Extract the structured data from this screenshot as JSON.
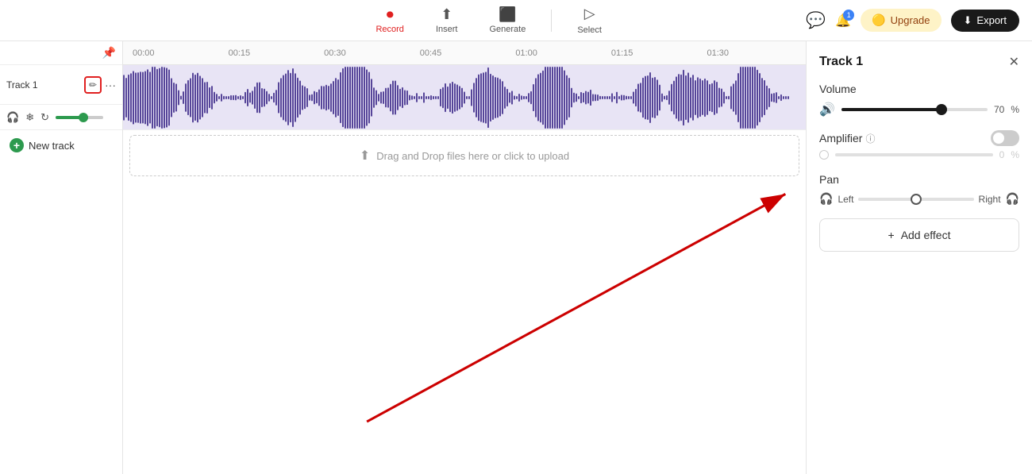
{
  "toolbar": {
    "record_label": "Record",
    "insert_label": "Insert",
    "generate_label": "Generate",
    "select_label": "Select",
    "export_label": "Export",
    "upgrade_label": "Upgrade",
    "notification_count": "1"
  },
  "timeline": {
    "marks": [
      "00:00",
      "00:15",
      "00:30",
      "00:45",
      "01:00",
      "01:15",
      "01:30"
    ]
  },
  "track": {
    "name": "Track 1",
    "volume_value": "70",
    "volume_pct": "%"
  },
  "new_track": {
    "label": "New track"
  },
  "drop_zone": {
    "text": "Drag and Drop files here or click to upload"
  },
  "right_panel": {
    "title": "Track 1",
    "volume_section": "Volume",
    "volume_value": "70",
    "volume_pct": "%",
    "amplifier_label": "Amplifier",
    "amp_value": "0",
    "amp_pct": "%",
    "pan_label": "Pan",
    "pan_left": "Left",
    "pan_right": "Right",
    "add_effect_label": "Add effect"
  }
}
